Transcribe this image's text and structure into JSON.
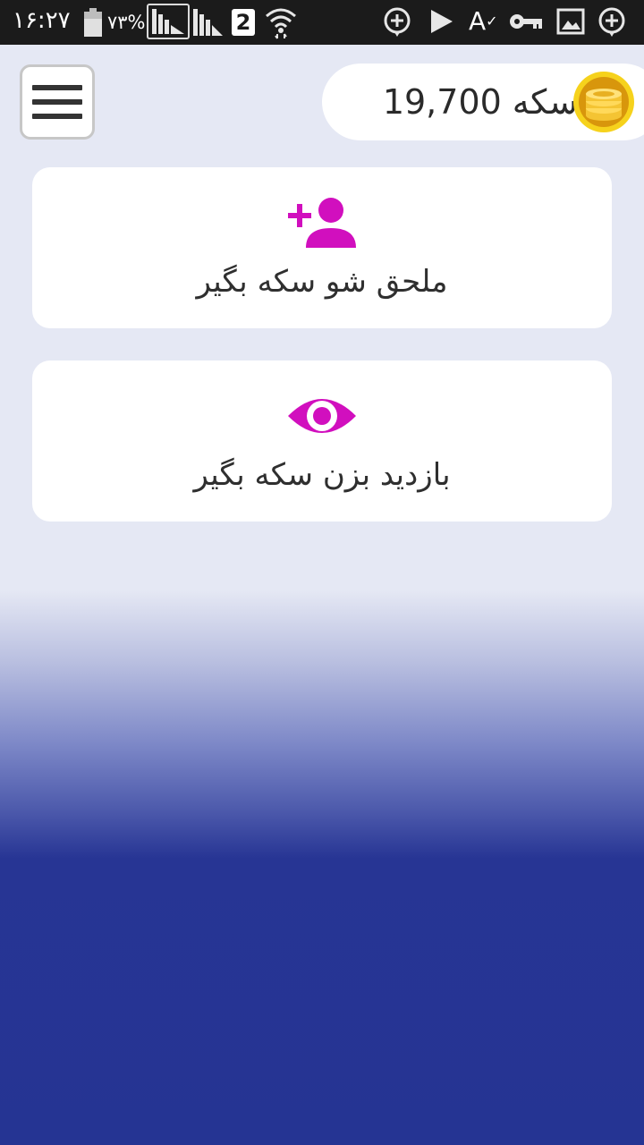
{
  "status_bar": {
    "time": "۱۶:۲۷",
    "battery_percent": "۷۳%",
    "sim_slot": "2",
    "icons": [
      "battery-icon",
      "signal-icon",
      "signal-icon-2",
      "wifi-icon",
      "add-circle-icon",
      "play-icon",
      "font-size-icon",
      "key-icon",
      "image-icon",
      "add-circle-icon-2"
    ],
    "font_icon_glyph": "A"
  },
  "header": {
    "menu_icon": "hamburger-menu-icon",
    "coin_value": "19,700",
    "coin_label": "سکه",
    "coin_icon": "coin-stack-icon"
  },
  "cards": [
    {
      "icon": "add-user-icon",
      "label": "ملحق شو سکه بگیر"
    },
    {
      "icon": "eye-icon",
      "label": "بازدید بزن سکه بگیر"
    }
  ],
  "colors": {
    "accent": "#d10fbe",
    "status_bar_bg": "#1b1b1b",
    "page_bg_top": "#e5e8f4",
    "page_bg_bottom": "#253493",
    "coin_gold": "#f2c22b"
  }
}
